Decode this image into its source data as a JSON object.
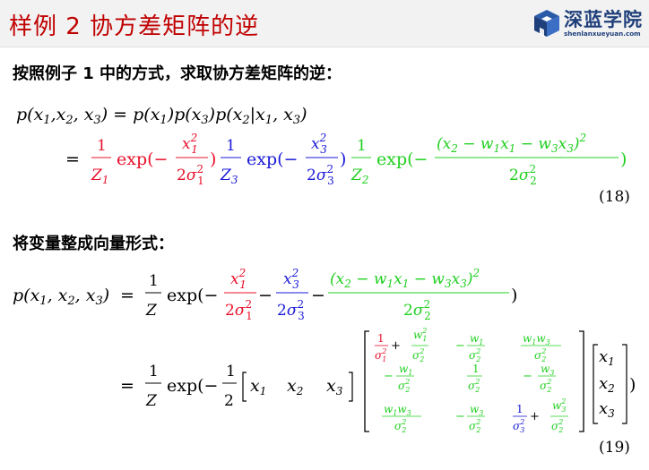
{
  "header": {
    "title": "样例 2 协方差矩阵的逆",
    "logo_text": "深蓝学院",
    "logo_url": "shenlanxueyuan.com"
  },
  "section1": {
    "text": "按照例子 1 中的方式，求取协方差矩阵的逆："
  },
  "section2": {
    "text": "将变量整成向量形式："
  },
  "equations": {
    "eq18_number": "(18)",
    "eq19_number": "(19)"
  },
  "colors": {
    "red": "#e8102a",
    "blue": "#1a1ad8",
    "green": "#20d020",
    "title": "#c00000",
    "logo": "#1f3f7a"
  }
}
